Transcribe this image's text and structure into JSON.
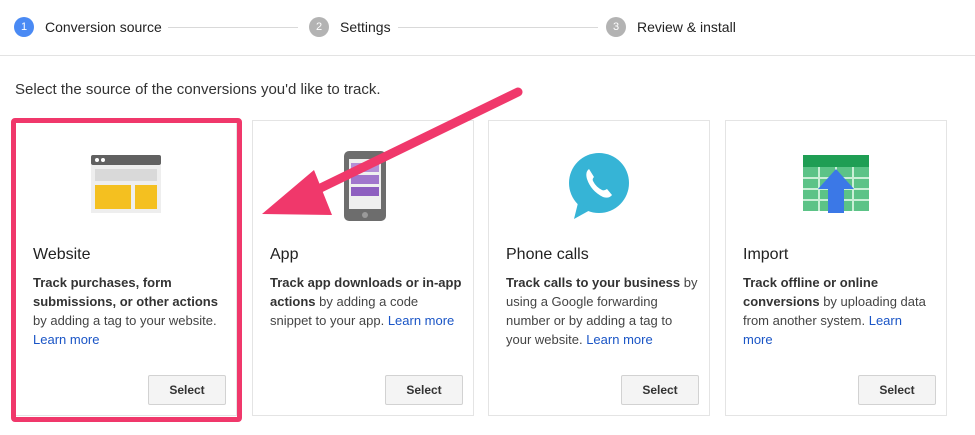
{
  "stepper": {
    "steps": [
      {
        "number": "1",
        "label": "Conversion source"
      },
      {
        "number": "2",
        "label": "Settings"
      },
      {
        "number": "3",
        "label": "Review & install"
      }
    ]
  },
  "prompt": "Select the source of the conversions you'd like to track.",
  "cards": [
    {
      "title": "Website",
      "desc_bold": "Track purchases, form submissions, or other actions",
      "desc_rest": " by adding a tag to your website. ",
      "link": "Learn more",
      "button": "Select",
      "icon": "website-icon"
    },
    {
      "title": "App",
      "desc_bold": "Track app downloads or in-app actions",
      "desc_rest": " by adding a code snippet to your app. ",
      "link": "Learn more",
      "button": "Select",
      "icon": "phone-app-icon"
    },
    {
      "title": "Phone calls",
      "desc_bold": "Track calls to your business",
      "desc_rest": " by using a Google forwarding number or by adding a tag to your website. ",
      "link": "Learn more",
      "button": "Select",
      "icon": "phone-call-icon"
    },
    {
      "title": "Import",
      "desc_bold": "Track offline or online conversions",
      "desc_rest": " by uploading data from another system. ",
      "link": "Learn more",
      "button": "Select",
      "icon": "import-spreadsheet-icon"
    }
  ],
  "annotation": {
    "color": "#f0386b"
  }
}
